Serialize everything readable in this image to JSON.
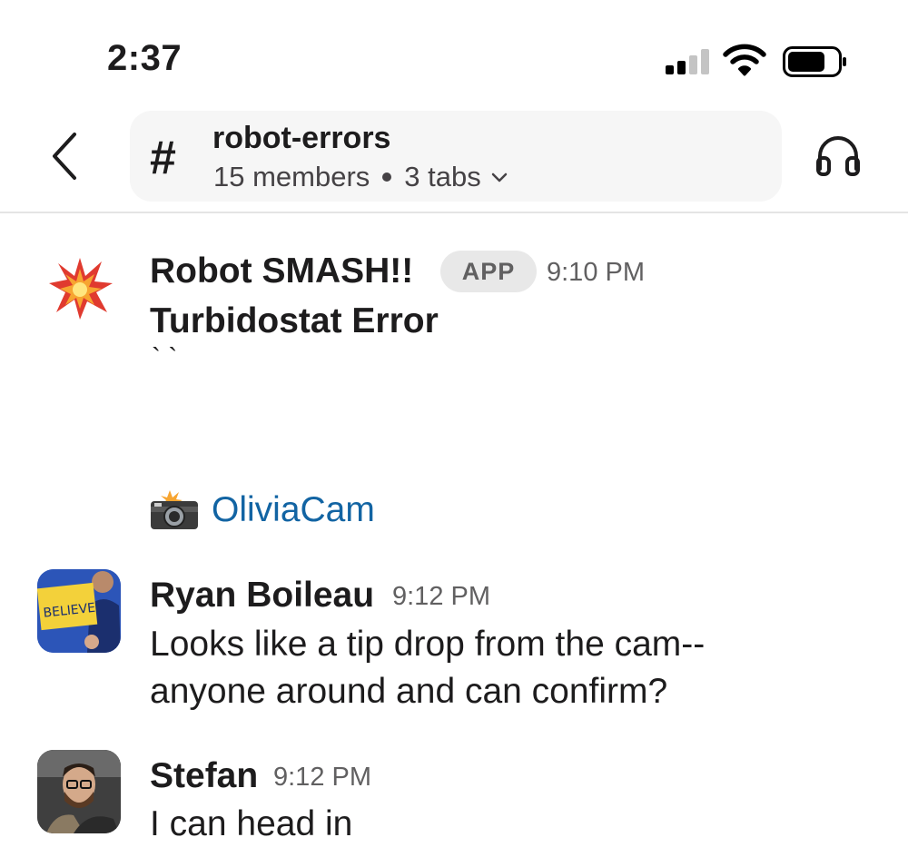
{
  "status_bar": {
    "time": "2:37"
  },
  "header": {
    "channel_prefix": "#",
    "channel_name": "robot-errors",
    "members": "15 members",
    "tabs": "3 tabs"
  },
  "messages": [
    {
      "author": "Robot SMASH!!",
      "badge": "APP",
      "time": "9:10 PM",
      "title": "Turbidostat Error",
      "body_extra": "` `",
      "link_label": "OliviaCam"
    },
    {
      "author": "Ryan Boileau",
      "time": "9:12 PM",
      "avatar_text": "BELIEVE",
      "lines": [
        "Looks like a tip drop from the cam--",
        "anyone around and can confirm?"
      ]
    },
    {
      "author": "Stefan",
      "time": "9:12 PM",
      "lines": [
        "I can head in"
      ]
    }
  ],
  "colors": {
    "link": "#1264a3",
    "pill_bg": "#f6f6f6",
    "text": "#1d1c1d",
    "muted": "#616061"
  },
  "icons": [
    "back-chevron-icon",
    "cellular-signal-icon",
    "wifi-icon",
    "battery-icon",
    "headphones-icon",
    "collision-emoji-icon",
    "camera-flash-emoji-icon"
  ]
}
